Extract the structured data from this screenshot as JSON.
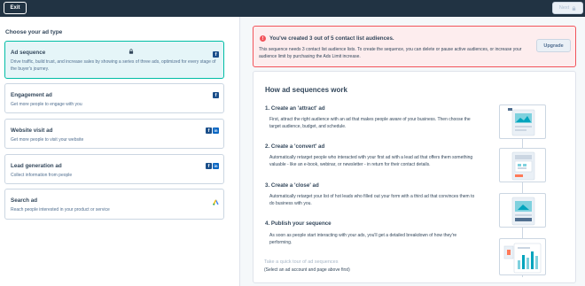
{
  "topbar": {
    "exit_label": "Exit",
    "next_label": "Next"
  },
  "left": {
    "title": "Choose your ad type",
    "cards": [
      {
        "title": "Ad sequence",
        "description": "Drive traffic, build trust, and increase sales by showing a series of three ads, optimized for every stage of the buyer's journey.",
        "selected": true
      },
      {
        "title": "Engagement ad",
        "description": "Get more people to engage with you"
      },
      {
        "title": "Website visit ad",
        "description": "Get more people to visit your website"
      },
      {
        "title": "Lead generation ad",
        "description": "Collect information from people"
      },
      {
        "title": "Search ad",
        "description": "Reach people interested in your product or service"
      }
    ]
  },
  "alert": {
    "icon_text": "!",
    "title": "You've created 3 out of 5 contact list audiences.",
    "body": "This sequence needs 3 contact list audience lists. To create the sequence, you can delete or pause active audiences, or increase your audience limit by purchasing the Ads Limit increase.",
    "upgrade_label": "Upgrade"
  },
  "how": {
    "title": "How ad sequences work",
    "steps": [
      {
        "title": "1. Create an 'attract' ad",
        "description": "First, attract the right audience with an ad that makes people aware of your business. Then choose the target audience, budget, and schedule."
      },
      {
        "title": "2. Create a 'convert' ad",
        "description": "Automatically retarget people who interacted with your first ad with a lead ad that offers them something valuable - like an e-book, webinar, or newsletter - in return for their contact details."
      },
      {
        "title": "3. Create a 'close' ad",
        "description": "Automatically retarget your list of hot leads who filled out your form with a third ad that convinces them to do business with you."
      },
      {
        "title": "4. Publish your sequence",
        "description": "As soon as people start interacting with your ads, you'll get a detailed breakdown of how they're performing."
      }
    ],
    "tour_link": "Take a quick tour of ad sequences",
    "tour_note": "(Select an ad account and page above first)"
  },
  "icons": {
    "facebook": "f",
    "linkedin": "in"
  },
  "colors": {
    "topbar": "#213343",
    "selected_card_bg": "#e5f5f8",
    "selected_card_border": "#00bda5",
    "alert_bg": "#fdedee",
    "alert_border": "#f2545b",
    "facebook": "#1b4f8a",
    "linkedin": "#0a66c2"
  }
}
